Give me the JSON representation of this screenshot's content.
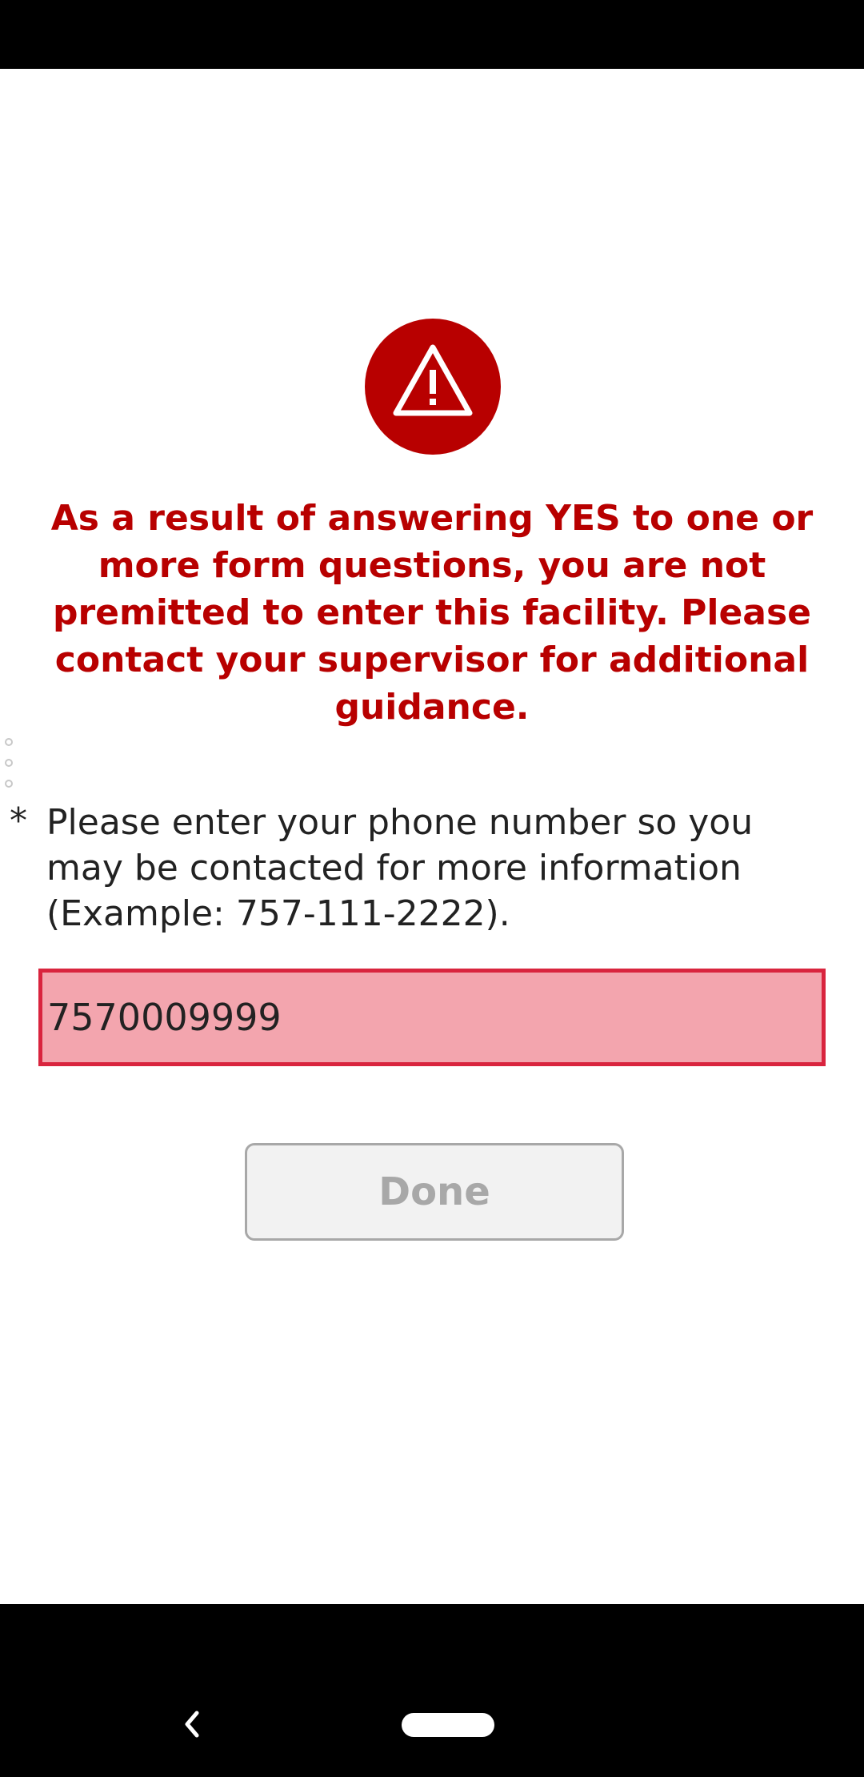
{
  "alert": {
    "icon": "warning-triangle-icon",
    "message": "As a result of answering YES to one or more form questions, you are not premitted to enter this facility. Please contact your supervisor for additional guidance."
  },
  "form": {
    "required_marker": "*",
    "question": "Please enter your phone number so you may be contacted for more information (Example: 757-111-2222).",
    "phone_value": "7570009999"
  },
  "actions": {
    "done_label": "Done"
  },
  "navigation": {
    "back_icon": "back-chevron-icon",
    "home_icon": "home-pill-icon"
  },
  "colors": {
    "alert_red": "#b80000",
    "error_border": "#d9243e",
    "error_fill": "#f3a5ae",
    "disabled_gray": "#a8a8a8"
  }
}
